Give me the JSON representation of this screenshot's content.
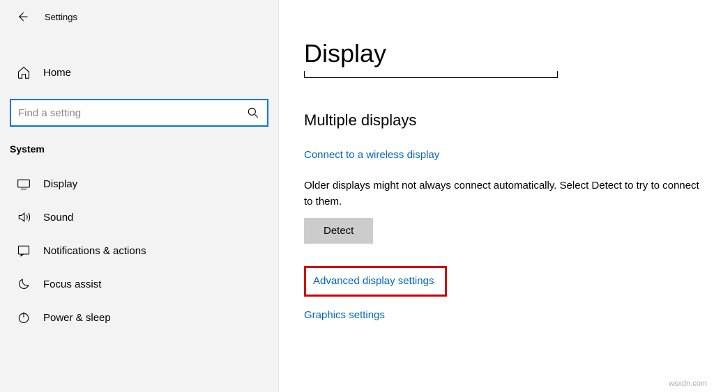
{
  "header": {
    "title": "Settings"
  },
  "sidebar": {
    "home": "Home",
    "search_placeholder": "Find a setting",
    "category": "System",
    "items": [
      {
        "label": "Display"
      },
      {
        "label": "Sound"
      },
      {
        "label": "Notifications & actions"
      },
      {
        "label": "Focus assist"
      },
      {
        "label": "Power & sleep"
      }
    ]
  },
  "content": {
    "page_title": "Display",
    "section_title": "Multiple displays",
    "wireless_link": "Connect to a wireless display",
    "older_text": "Older displays might not always connect automatically. Select Detect to try to connect to them.",
    "detect_label": "Detect",
    "advanced_link": "Advanced display settings",
    "graphics_link": "Graphics settings"
  },
  "watermark": "wsxdn.com"
}
